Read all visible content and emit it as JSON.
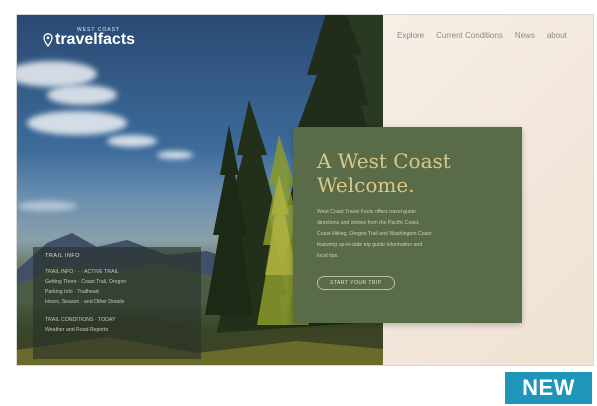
{
  "logo": {
    "small_text": "WEST COAST",
    "main_text": "travelfacts"
  },
  "nav": [
    "Explore",
    "Current Conditions",
    "News",
    "about"
  ],
  "welcome": {
    "title_line1": "A West Coast",
    "title_line2": "Welcome.",
    "body_lines": [
      "West Coast Travel Facts offers travel guide",
      "directions and stories from the Pacific Coast,",
      "Coast Hiking, Oregon Trail and Washington Coast",
      "featuring up-to-date trip guide information and",
      "local tips."
    ],
    "button_label": "START YOUR TRIP"
  },
  "info": {
    "label": "TRAIL INFO",
    "lines": [
      "TRAIL INFO · · · ACTIVE TRAIL",
      "Getting There · Coast Trail, Oregon",
      "Parking Info · Trailhead",
      "Hours, Season · and Other Details",
      "TRAIL CONDITIONS · TODAY",
      "Weather and Road Reports"
    ]
  },
  "badge": {
    "label": "NEW"
  },
  "colors": {
    "panel_green": "#5a6b48",
    "title_gold": "#d8c98a",
    "badge_blue": "#1f95b8",
    "cream": "#f4ece3"
  }
}
